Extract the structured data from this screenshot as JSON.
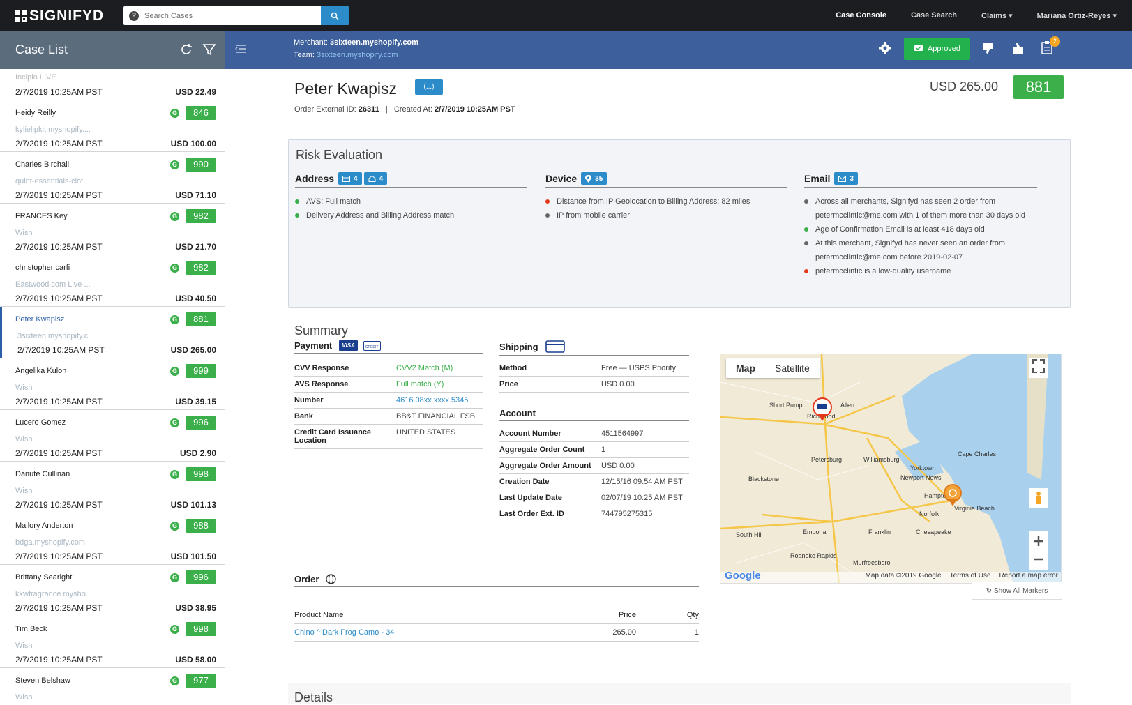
{
  "topbar": {
    "logo": "SIGNIFYD",
    "search_placeholder": "Search Cases",
    "nav": [
      "Case Console",
      "Case Search",
      "Claims ▾",
      "Mariana Ortiz-Reyes ▾"
    ]
  },
  "sidebar": {
    "title": "Case List",
    "first": {
      "sub": "Incipio LIVE",
      "date": "2/7/2019 10:25AM PST",
      "amount": "USD 22.49"
    },
    "cases": [
      {
        "name": "Heidy Reilly",
        "sub": "kylielipkit.myshopify....",
        "date": "2/7/2019 10:25AM PST",
        "amount": "USD 100.00",
        "score": "846"
      },
      {
        "name": "Charles Birchall",
        "sub": "quint-essentials-clot...",
        "date": "2/7/2019 10:25AM PST",
        "amount": "USD 71.10",
        "score": "990"
      },
      {
        "name": "FRANCES Key",
        "sub": "Wish",
        "date": "2/7/2019 10:25AM PST",
        "amount": "USD 21.70",
        "score": "982"
      },
      {
        "name": "christopher carfi",
        "sub": "Eastwood.com Live ...",
        "date": "2/7/2019 10:25AM PST",
        "amount": "USD 40.50",
        "score": "982"
      },
      {
        "name": "Peter Kwapisz",
        "sub": "3sixteen.myshopify.c...",
        "date": "2/7/2019 10:25AM PST",
        "amount": "USD 265.00",
        "score": "881"
      },
      {
        "name": "Angelika Kulon",
        "sub": "Wish",
        "date": "2/7/2019 10:25AM PST",
        "amount": "USD 39.15",
        "score": "999"
      },
      {
        "name": "Lucero Gomez",
        "sub": "Wish",
        "date": "2/7/2019 10:25AM PST",
        "amount": "USD 2.90",
        "score": "996"
      },
      {
        "name": "Danute Cullinan",
        "sub": "Wish",
        "date": "2/7/2019 10:25AM PST",
        "amount": "USD 101.13",
        "score": "998"
      },
      {
        "name": "Mallory Anderton",
        "sub": "bdga.myshopify.com",
        "date": "2/7/2019 10:25AM PST",
        "amount": "USD 101.50",
        "score": "988"
      },
      {
        "name": "Brittany Searight",
        "sub": "kkwfragrance.mysho...",
        "date": "2/7/2019 10:25AM PST",
        "amount": "USD 38.95",
        "score": "996"
      },
      {
        "name": "Tim Beck",
        "sub": "Wish",
        "date": "2/7/2019 10:25AM PST",
        "amount": "USD 58.00",
        "score": "998"
      },
      {
        "name": "Steven Belshaw",
        "sub": "Wish",
        "date": "",
        "amount": "",
        "score": "977"
      }
    ]
  },
  "merchant": {
    "merchant_label": "Merchant:",
    "merchant": "3sixteen.myshopify.com",
    "team_label": "Team:",
    "team": "3sixteen.myshopify.com",
    "approved": "Approved",
    "notes_count": "2"
  },
  "case": {
    "name": "Peter Kwapisz",
    "tag": "(...)",
    "order_ext_label": "Order External ID:",
    "order_ext": "26311",
    "created_label": "Created At:",
    "created": "2/7/2019 10:25AM PST",
    "total": "USD 265.00",
    "score": "881"
  },
  "risk": {
    "title": "Risk Evaluation",
    "address": {
      "title": "Address",
      "pill1": "4",
      "pill2": "4",
      "items": [
        {
          "text": "AVS: Full match",
          "color": "#3bb04a"
        },
        {
          "text": "Delivery Address and Billing Address match",
          "color": "#3bb04a"
        }
      ]
    },
    "device": {
      "title": "Device",
      "pill1": "35",
      "items": [
        {
          "text": "Distance from IP Geolocation to Billing Address: 82 miles",
          "color": "#e5381b"
        },
        {
          "text": "IP from mobile carrier",
          "color": "#666666"
        }
      ]
    },
    "email": {
      "title": "Email",
      "pill1": "3",
      "items": [
        {
          "text": "Across all merchants, Signifyd has seen 2 order from petermcclintic@me.com with 1 of them more than 30 days old",
          "color": "#666666"
        },
        {
          "text": "Age of Confirmation Email is at least 418 days old",
          "color": "#3bb04a"
        },
        {
          "text": "At this merchant, Signifyd has never seen an order from petermcclintic@me.com before 2019-02-07",
          "color": "#666666"
        },
        {
          "text": "petermcclintic is a low-quality username",
          "color": "#e5381b"
        }
      ]
    }
  },
  "summary": {
    "title": "Summary",
    "payment": {
      "title": "Payment",
      "card_brand": "VISA",
      "card_type": "CREDIT",
      "rows": [
        {
          "k": "CVV Response",
          "v": "CVV2 Match (M)",
          "style": "green"
        },
        {
          "k": "AVS Response",
          "v": "Full match (Y)",
          "style": "green"
        },
        {
          "k": "Number",
          "v": "4616 08xx xxxx 5345",
          "style": "blue"
        },
        {
          "k": "Bank",
          "v": "BB&T FINANCIAL FSB",
          "style": ""
        },
        {
          "k": "Credit Card Issuance Location",
          "v": "UNITED STATES",
          "style": ""
        }
      ]
    },
    "shipping": {
      "title": "Shipping",
      "rows": [
        {
          "k": "Method",
          "v": "Free — USPS Priority"
        },
        {
          "k": "Price",
          "v": "USD 0.00"
        }
      ]
    },
    "account": {
      "title": "Account",
      "rows": [
        {
          "k": "Account Number",
          "v": "4511564997"
        },
        {
          "k": "Aggregate Order Count",
          "v": "1"
        },
        {
          "k": "Aggregate Order Amount",
          "v": "USD 0.00"
        },
        {
          "k": "Creation Date",
          "v": "12/15/16 09:54 AM PST"
        },
        {
          "k": "Last Update Date",
          "v": "02/07/19 10:25 AM PST"
        },
        {
          "k": "Last Order Ext. ID",
          "v": "744795275315"
        }
      ]
    },
    "order": {
      "title": "Order",
      "headers": [
        "Product Name",
        "Price",
        "Qty"
      ],
      "rows": [
        {
          "name": "Chino ^ Dark Frog Camo - 34",
          "price": "265.00",
          "qty": "1"
        }
      ]
    }
  },
  "map": {
    "tab_map": "Map",
    "tab_satellite": "Satellite",
    "labels": [
      "Short Pump",
      "Richmond",
      "Petersburg",
      "Williamsburg",
      "Newport News",
      "Hampton",
      "Norfolk",
      "Virginia Beach",
      "Chesapeake",
      "Blackstone",
      "South Hill",
      "Emporia",
      "Franklin",
      "Cape Charles",
      "Yorktown",
      "Murfreesboro",
      "Roanoke Rapids",
      "Allen"
    ],
    "brand": "Google",
    "footer": [
      "Map data ©2019 Google",
      "Terms of Use",
      "Report a map error"
    ],
    "show_all": "Show All Markers"
  },
  "details": {
    "title": "Details"
  }
}
